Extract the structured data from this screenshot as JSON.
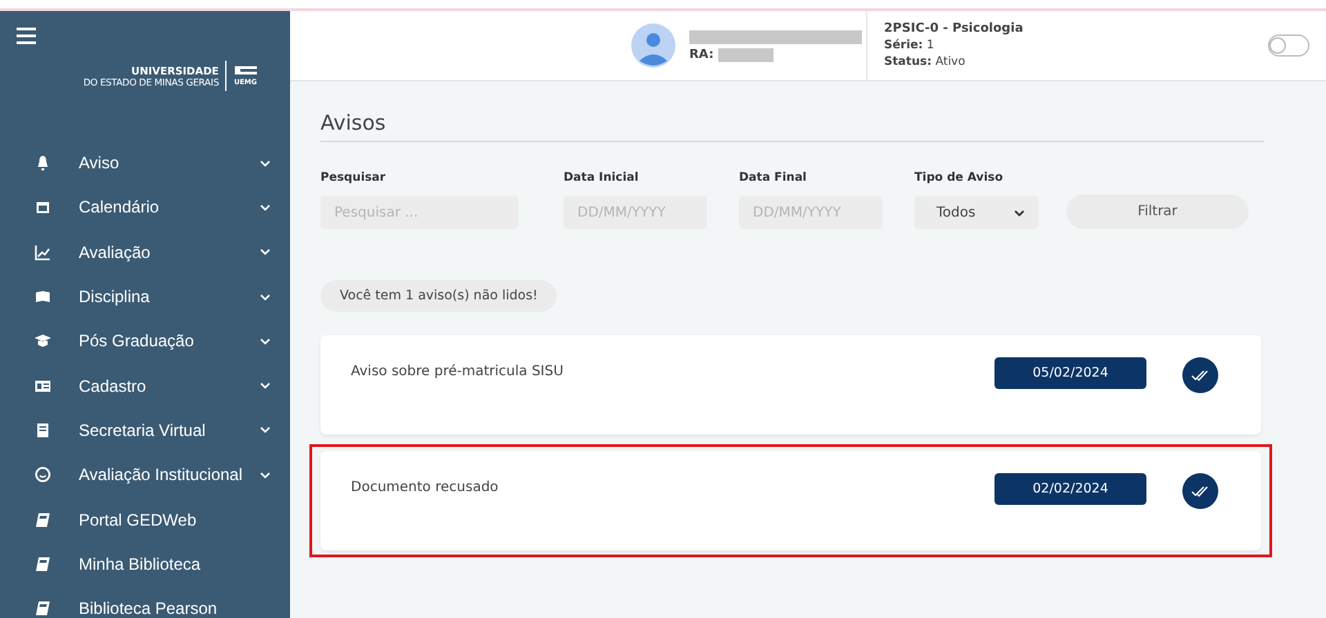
{
  "sidebar": {
    "logo": {
      "line1": "UNIVERSIDADE",
      "line2": "DO ESTADO DE MINAS GERAIS",
      "mark": "UEMG"
    },
    "items": [
      {
        "label": "Aviso",
        "expandable": true
      },
      {
        "label": "Calendário",
        "expandable": true
      },
      {
        "label": "Avaliação",
        "expandable": true
      },
      {
        "label": "Disciplina",
        "expandable": true
      },
      {
        "label": "Pós Graduação",
        "expandable": true
      },
      {
        "label": "Cadastro",
        "expandable": true
      },
      {
        "label": "Secretaria Virtual",
        "expandable": true
      },
      {
        "label": "Avaliação Institucional",
        "expandable": true
      },
      {
        "label": "Portal GEDWeb",
        "expandable": false
      },
      {
        "label": "Minha Biblioteca",
        "expandable": false
      },
      {
        "label": "Biblioteca Pearson",
        "expandable": false
      }
    ]
  },
  "header": {
    "ra_label": "RA:",
    "course": "2PSIC-0 - Psicologia",
    "serie_label": "Série:",
    "serie": "1",
    "status_label": "Status:",
    "status": "Ativo",
    "toggle_on": false
  },
  "page_title": "Avisos",
  "filters": {
    "search": {
      "label": "Pesquisar",
      "placeholder": "Pesquisar ..."
    },
    "start_date": {
      "label": "Data Inicial",
      "placeholder": "DD/MM/YYYY"
    },
    "end_date": {
      "label": "Data Final",
      "placeholder": "DD/MM/YYYY"
    },
    "type": {
      "label": "Tipo de Aviso",
      "value": "Todos"
    },
    "button": "Filtrar"
  },
  "unread_badge": "Você tem 1 aviso(s) não lidos!",
  "notices": [
    {
      "title": "Aviso sobre pré-matricula SISU",
      "date": "05/02/2024",
      "highlighted": false
    },
    {
      "title": "Documento recusado",
      "date": "02/02/2024",
      "highlighted": true
    }
  ]
}
